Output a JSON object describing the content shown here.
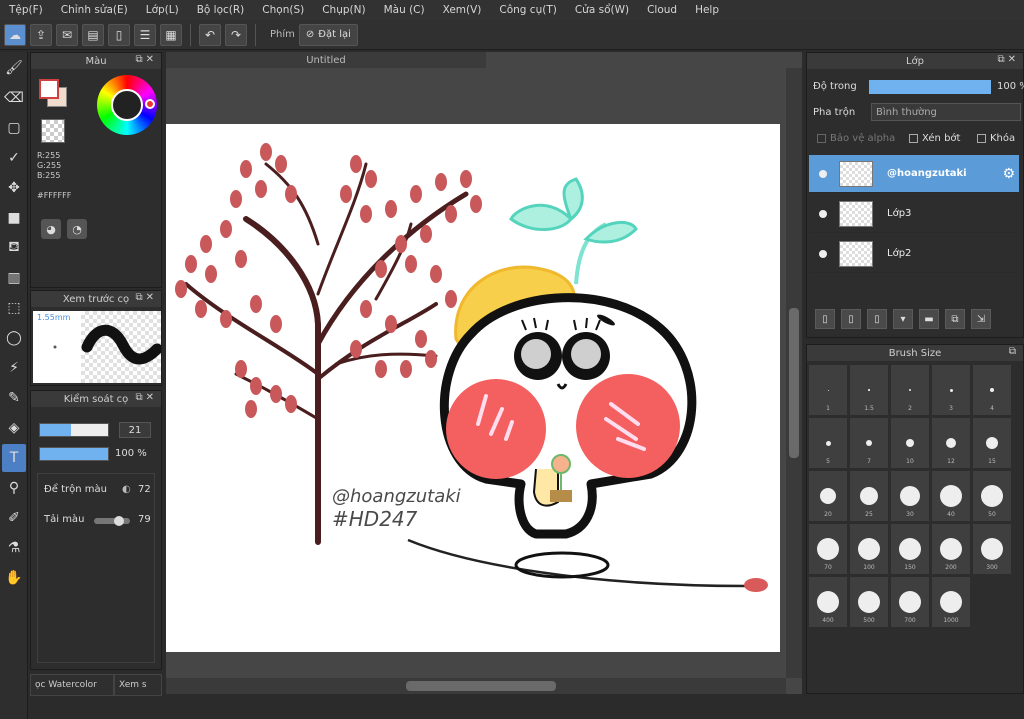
{
  "menu": [
    "Tệp(F)",
    "Chỉnh sửa(E)",
    "Lớp(L)",
    "Bộ lọc(R)",
    "Chọn(S)",
    "Chụp(N)",
    "Màu (C)",
    "Xem(V)",
    "Công cụ(T)",
    "Cửa sổ(W)",
    "Cloud",
    "Help"
  ],
  "toolbar": {
    "key_label": "Phím",
    "reset_label": "Đặt lại"
  },
  "color_panel": {
    "title": "Màu",
    "rgb": [
      "R:255",
      "G:255",
      "B:255"
    ],
    "hex": "#FFFFFF",
    "fg_color": "#ffffff",
    "accent": "#d04040"
  },
  "preview_panel": {
    "title": "Xem trước cọ",
    "size": "1.55mm"
  },
  "brush_control": {
    "title": "Kiểm soát cọ",
    "size_value": "21",
    "size_fill": 0.45,
    "opacity_value": "100 %",
    "opacity_fill": 1.0,
    "blend_label": "Để trộn màu",
    "blend_value": "72",
    "reload_label": "Tải màu",
    "reload_value": "79"
  },
  "bottom_tabs": [
    "ọc Watercolor",
    "Xem s"
  ],
  "document": {
    "tab": "Untitled"
  },
  "artwork": {
    "watermark": "@hoangzutaki",
    "tag": "#HD247"
  },
  "layer_panel": {
    "title": "Lớp",
    "opacity_label": "Độ trong",
    "opacity_value": "100 %",
    "blend_label": "Pha trộn",
    "blend_value": "Bình thường",
    "protect_alpha": "Bảo vệ alpha",
    "clip": "Xén bớt",
    "lock": "Khóa",
    "layers": [
      {
        "name": "@hoangzutaki",
        "active": true
      },
      {
        "name": "Lớp3",
        "active": false
      },
      {
        "name": "Lớp2",
        "active": false
      }
    ]
  },
  "brush_size_panel": {
    "title": "Brush Size",
    "sizes": [
      "1",
      "1.5",
      "2",
      "3",
      "4",
      "5",
      "7",
      "10",
      "12",
      "15",
      "20",
      "25",
      "30",
      "40",
      "50",
      "70",
      "100",
      "150",
      "200",
      "300",
      "400",
      "500",
      "700",
      "1000"
    ]
  }
}
